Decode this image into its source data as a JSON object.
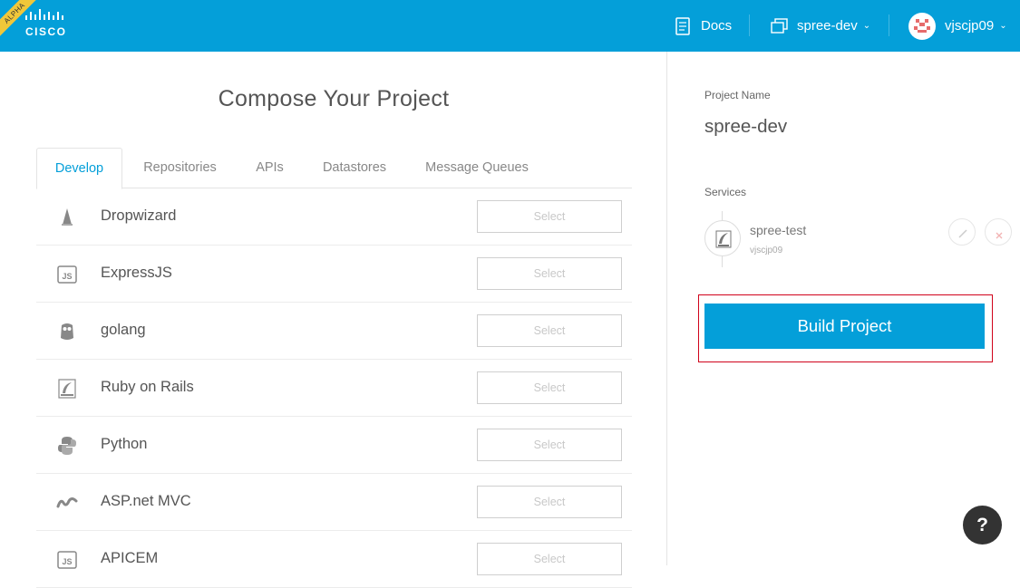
{
  "header": {
    "badge": "ALPHA",
    "brand": "CISCO",
    "docs_label": "Docs",
    "project_menu_label": "spree-dev",
    "user_label": "vjscjp09"
  },
  "compose": {
    "title": "Compose Your Project",
    "tabs": [
      {
        "label": "Develop",
        "active": true
      },
      {
        "label": "Repositories",
        "active": false
      },
      {
        "label": "APIs",
        "active": false
      },
      {
        "label": "Datastores",
        "active": false
      },
      {
        "label": "Message Queues",
        "active": false
      }
    ],
    "items": [
      {
        "label": "Dropwizard",
        "icon": "dropwizard-icon",
        "button": "Select"
      },
      {
        "label": "ExpressJS",
        "icon": "js-icon",
        "button": "Select"
      },
      {
        "label": "golang",
        "icon": "gopher-icon",
        "button": "Select"
      },
      {
        "label": "Ruby on Rails",
        "icon": "rails-icon",
        "button": "Select"
      },
      {
        "label": "Python",
        "icon": "python-icon",
        "button": "Select"
      },
      {
        "label": "ASP.net MVC",
        "icon": "aspnet-icon",
        "button": "Select"
      },
      {
        "label": "APICEM",
        "icon": "js-icon",
        "button": "Select"
      }
    ]
  },
  "project": {
    "name_label": "Project Name",
    "name_value": "spree-dev",
    "services_label": "Services",
    "services": [
      {
        "name": "spree-test",
        "owner": "vjscjp09",
        "icon": "rails-icon"
      }
    ],
    "build_label": "Build Project"
  },
  "help": {
    "label": "?"
  },
  "colors": {
    "brand": "#049fd9",
    "highlight": "#d0021b",
    "alpha_badge": "#f0c73a"
  }
}
